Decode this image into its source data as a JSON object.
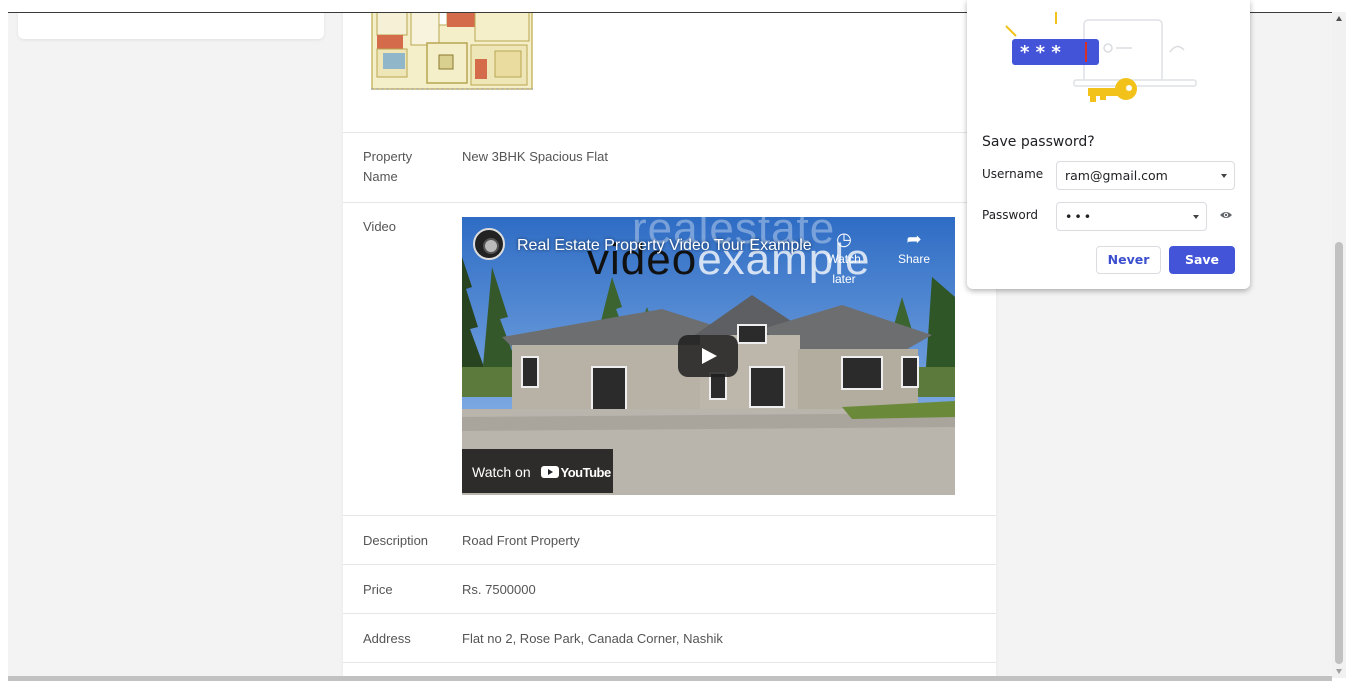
{
  "property": {
    "rows": [
      {
        "label": "Property\nName",
        "value": "New 3BHK Spacious Flat"
      },
      {
        "label": "Video"
      },
      {
        "label": "Description",
        "value": "Road Front Property"
      },
      {
        "label": "Price",
        "value": "Rs. 7500000"
      },
      {
        "label": "Address",
        "value": "Flat no 2, Rose Park, Canada Corner, Nashik"
      }
    ]
  },
  "video": {
    "title": "Real Estate Property Video Tour Example",
    "overlay_line1": "realestate",
    "overlay_line2_a": "video",
    "overlay_line2_b": "example",
    "watch_later": "Watch later",
    "share": "Share",
    "watch_on": "Watch on",
    "youtube": "YouTube"
  },
  "password_prompt": {
    "title": "Save password?",
    "username_label": "Username",
    "username_value": "ram@gmail.com",
    "password_label": "Password",
    "password_value": "•••",
    "never_label": "Never",
    "save_label": "Save",
    "illustration_text": "* * *",
    "accent_color": "#4354d8"
  },
  "icons": [
    "floorplan-image",
    "clock-icon",
    "share-arrow-icon",
    "play-icon",
    "youtube-logo",
    "key-icon",
    "eye-icon",
    "chevron-down-icon"
  ]
}
